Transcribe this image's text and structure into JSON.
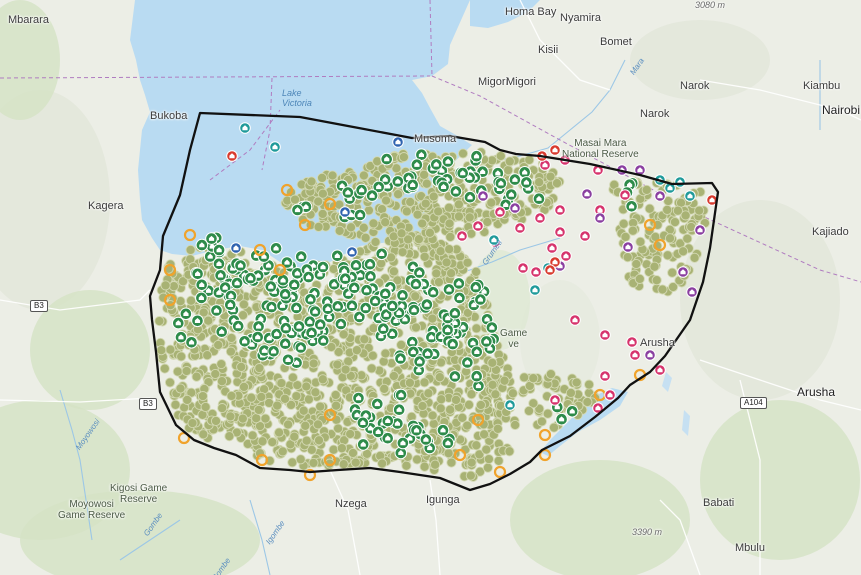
{
  "map": {
    "colors": {
      "water": "#b9dbf2",
      "land": "#eceee6",
      "hills": "#e2e6da",
      "green_area": "#d4e2c4",
      "dense_marker": "#a8b274",
      "dense_marker_stroke": "#d4d9b4",
      "forest_marker": "#2e8b4a",
      "boundary": "#111111",
      "orange_ring": "#f0a32c",
      "purple_marker": "#8a3fa0",
      "pink_marker": "#d6336c",
      "teal_marker": "#1f9a9a",
      "red_marker": "#d83a2e",
      "blue_marker": "#2f63b0",
      "road": "#ffffff",
      "border_line": "#b07cc0"
    },
    "marker_icons": [
      "tree-icon",
      "grain-icon",
      "shop-icon",
      "hospital-icon",
      "house-icon"
    ],
    "places": [
      {
        "name": "Mbarara",
        "cls": "place"
      },
      {
        "name": "Homa Bay",
        "cls": "place"
      },
      {
        "name": "Nyamira",
        "cls": "place"
      },
      {
        "name": "Kisii",
        "cls": "place"
      },
      {
        "name": "Bomet",
        "cls": "place"
      },
      {
        "name": "Migori",
        "cls": "place"
      },
      {
        "name": "Migori",
        "cls": "place"
      },
      {
        "name": "Narok",
        "cls": "place"
      },
      {
        "name": "Narok",
        "cls": "place"
      },
      {
        "name": "Kiambu",
        "cls": "place"
      },
      {
        "name": "Nairobi",
        "cls": "place city"
      },
      {
        "name": "Bukoba",
        "cls": "place"
      },
      {
        "name": "Lake\nVictoria",
        "cls": "place water"
      },
      {
        "name": "Kagera",
        "cls": "place"
      },
      {
        "name": "Musoma",
        "cls": "place"
      },
      {
        "name": "Masai Mara\nNational Reserve",
        "cls": "place reserve"
      },
      {
        "name": "Kajiado",
        "cls": "place"
      },
      {
        "name": "Arusha",
        "cls": "place"
      },
      {
        "name": "Arusha",
        "cls": "place city"
      },
      {
        "name": "Game\nve",
        "cls": "place reserve"
      },
      {
        "name": "Kigosi Game\nReserve",
        "cls": "place reserve"
      },
      {
        "name": "Moyowosi\nGame Reserve",
        "cls": "place reserve"
      },
      {
        "name": "Nzega",
        "cls": "place"
      },
      {
        "name": "Igunga",
        "cls": "place"
      },
      {
        "name": "Babati",
        "cls": "place"
      },
      {
        "name": "Mbulu",
        "cls": "place"
      },
      {
        "name": "3080 m",
        "cls": "place elev"
      },
      {
        "name": "3390 m",
        "cls": "place elev"
      },
      {
        "name": "Mara",
        "cls": "place river"
      },
      {
        "name": "Grumeti",
        "cls": "place river"
      },
      {
        "name": "Moyowosi",
        "cls": "place river"
      },
      {
        "name": "Igombe",
        "cls": "place river"
      },
      {
        "name": "Gombe",
        "cls": "place river"
      },
      {
        "name": "Gombe",
        "cls": "place river"
      }
    ],
    "shields": [
      "B3",
      "B3",
      "A104"
    ]
  }
}
